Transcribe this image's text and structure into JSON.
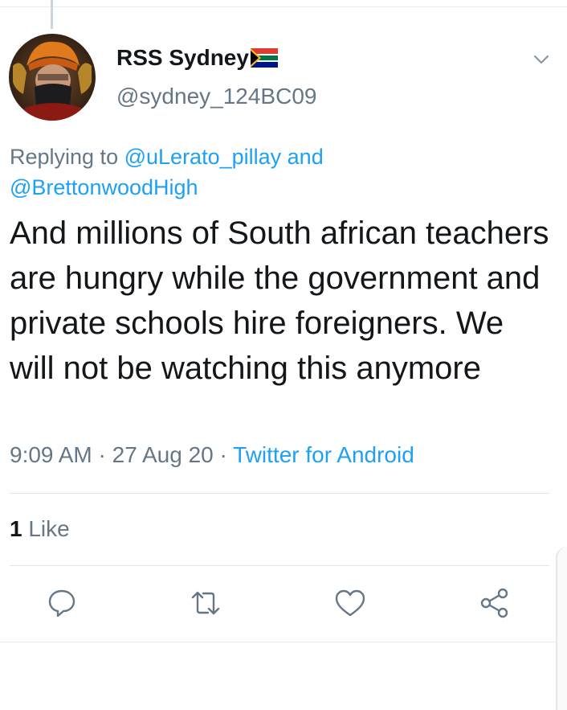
{
  "author": {
    "display_name": "RSS Sydney",
    "handle": "@sydney_124BC09",
    "flag_icon": "south-africa-flag-icon"
  },
  "reply_context": {
    "prefix": "Replying to",
    "mention_1": "@uLerato_pillay",
    "conjunction": "and",
    "mention_2": "@BrettonwoodHigh"
  },
  "tweet": {
    "text": "And millions of South african teachers are hungry while the government and private schools hire foreigners. We will not be watching this anymore",
    "time": "9:09 AM",
    "separator": "·",
    "date": "27 Aug 20",
    "source": "Twitter for Android"
  },
  "stats": {
    "likes_count": "1",
    "likes_label": "Like"
  },
  "actions": {
    "reply_icon": "reply-icon",
    "retweet_icon": "retweet-icon",
    "like_icon": "heart-icon",
    "share_icon": "share-icon"
  },
  "colors": {
    "link": "#1da1f2",
    "secondary": "#657786",
    "text": "#14171a"
  }
}
